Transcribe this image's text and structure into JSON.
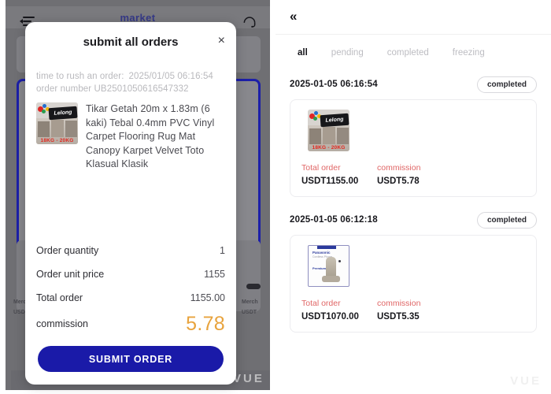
{
  "left_panel": {
    "topbar": {
      "title": "market",
      "menu_icon": "collapse-menu-icon",
      "support_icon": "headset-support-icon"
    },
    "background_text": {
      "merchant_left": "Merc",
      "usdt_left": "USD",
      "merchant_right": "Merch",
      "usdt_right": "USDT"
    },
    "modal": {
      "title": "submit all orders",
      "close_label": "×",
      "time_label": "time to rush an order:",
      "time_value": "2025/01/05 06:16:54",
      "order_number_label": "order number",
      "order_number_value": "UB2501050616547332",
      "product": {
        "title": "Tikar Getah 20m x 1.83m (6 kaki) Tebal 0.4mm PVC Vinyl Carpet Flooring Rug Mat Canopy Karpet Velvet Toto Klasual Klasik",
        "thumb_brand": "Lelong",
        "thumb_weight": "18KG - 20KG"
      },
      "summary": [
        {
          "label": "Order quantity",
          "value": "1"
        },
        {
          "label": "Order unit price",
          "value": "1155"
        },
        {
          "label": "Total order",
          "value": "1155.00"
        }
      ],
      "commission_label": "commission",
      "commission_value": "5.78",
      "submit_label": "SUBMIT ORDER",
      "accent_color": "#1a1aa8",
      "commission_color": "#e8a33d"
    },
    "watermark": "VUE"
  },
  "right_panel": {
    "back_icon": "double-chevron-left-icon",
    "tabs": [
      {
        "label": "all",
        "active": true
      },
      {
        "label": "pending",
        "active": false
      },
      {
        "label": "completed",
        "active": false
      },
      {
        "label": "freezing",
        "active": false
      }
    ],
    "orders": [
      {
        "date": "2025-01-05 06:16:54",
        "status": "completed",
        "thumb": "carpet-mat-product-image",
        "total_order_label": "Total order",
        "commission_label": "commission",
        "total_order_value": "USDT1155.00",
        "commission_value": "USDT5.78"
      },
      {
        "date": "2025-01-05 06:12:18",
        "status": "completed",
        "thumb": "panasonic-cordless-phone-image",
        "total_order_label": "Total order",
        "commission_label": "commission",
        "total_order_value": "USDT1070.00",
        "commission_value": "USDT5.35"
      }
    ],
    "watermark": "VUE",
    "label_color": "#e06666"
  }
}
